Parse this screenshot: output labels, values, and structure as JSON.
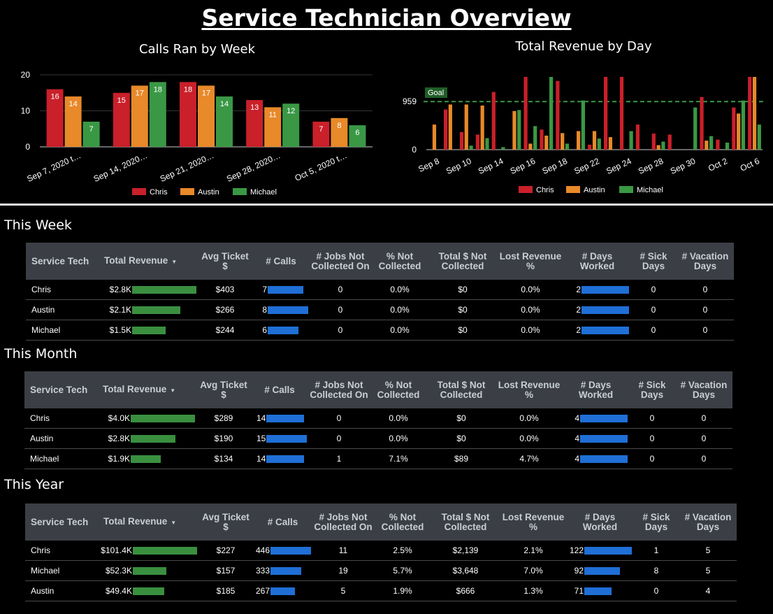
{
  "page_title": "Service Technician Overview",
  "colors": {
    "chris": "#c9202a",
    "austin": "#e8892a",
    "michael": "#3a9845",
    "revenue_bar": "#3a8f3f",
    "metric_bar": "#1f6fd6",
    "goal": "#3a9845",
    "header_bg": "#3b3f45"
  },
  "chart_data": [
    {
      "type": "bar",
      "title": "Calls Ran by Week",
      "categories": [
        "Sep 7, 2020 t…",
        "Sep 14, 2020…",
        "Sep 21, 2020…",
        "Sep 28, 2020…",
        "Oct 5, 2020 t…"
      ],
      "series": [
        {
          "name": "Chris",
          "values": [
            16,
            15,
            18,
            13,
            7
          ]
        },
        {
          "name": "Austin",
          "values": [
            14,
            17,
            17,
            11,
            8
          ]
        },
        {
          "name": "Michael",
          "values": [
            7,
            18,
            14,
            12,
            6
          ]
        }
      ],
      "yticks": [
        "0",
        "10",
        "20"
      ],
      "ylim": [
        0,
        21
      ],
      "data_labels": true,
      "grid": true,
      "legend": "bottom"
    },
    {
      "type": "bar",
      "title": "Total Revenue by Day",
      "x": [
        "Sep 8",
        "Sep 9",
        "Sep 10",
        "Sep 11",
        "Sep 14",
        "Sep 15",
        "Sep 16",
        "Sep 17",
        "Sep 18",
        "Sep 21",
        "Sep 22",
        "Sep 23",
        "Sep 24",
        "Sep 25",
        "Sep 28",
        "Sep 29",
        "Sep 30",
        "Oct 1",
        "Oct 2",
        "Oct 5",
        "Oct 6"
      ],
      "xtick_labels": [
        "Sep 8",
        "Sep 10",
        "Sep 14",
        "Sep 16",
        "Sep 18",
        "Sep 22",
        "Sep 24",
        "Sep 28",
        "Sep 30",
        "Oct 2",
        "Oct 6"
      ],
      "series": [
        {
          "name": "Chris",
          "values": [
            0,
            800,
            350,
            300,
            1150,
            0,
            1450,
            400,
            1370,
            0,
            100,
            1450,
            1450,
            500,
            320,
            300,
            0,
            1050,
            200,
            840,
            1450
          ]
        },
        {
          "name": "Austin",
          "values": [
            500,
            900,
            900,
            880,
            0,
            770,
            120,
            280,
            330,
            370,
            370,
            250,
            0,
            0,
            90,
            0,
            0,
            180,
            0,
            720,
            1450
          ]
        },
        {
          "name": "Michael",
          "values": [
            0,
            0,
            80,
            230,
            50,
            790,
            470,
            1450,
            120,
            980,
            220,
            0,
            370,
            0,
            160,
            0,
            840,
            270,
            140,
            980,
            500
          ]
        }
      ],
      "yticks": [
        "0",
        "959"
      ],
      "goal": {
        "label": "Goal",
        "value": 959
      },
      "ylim": [
        0,
        1450
      ],
      "legend": "bottom"
    }
  ],
  "sections": [
    {
      "title": "This Week",
      "columns": [
        "Service Tech",
        "Total Revenue",
        "Avg Ticket $",
        "# Calls",
        "# Jobs Not Collected On",
        "% Not Collected",
        "Total $ Not Collected",
        "Lost Revenue %",
        "# Days Worked",
        "# Sick Days",
        "# Vacation Days"
      ],
      "sort_indicator": "▼",
      "rows": [
        {
          "tech": "Chris",
          "revenue": "$2.8K",
          "revenue_frac": 1.0,
          "avg_ticket": "$403",
          "calls": "7",
          "calls_frac": 0.88,
          "jobs_not_collected": "0",
          "pct_not_collected": "0.0%",
          "total_not_collected": "$0",
          "lost_revenue": "0.0%",
          "days_worked": "2",
          "days_frac": 1.0,
          "sick_days": "0",
          "vacation_days": "0"
        },
        {
          "tech": "Austin",
          "revenue": "$2.1K",
          "revenue_frac": 0.75,
          "avg_ticket": "$266",
          "calls": "8",
          "calls_frac": 1.0,
          "jobs_not_collected": "0",
          "pct_not_collected": "0.0%",
          "total_not_collected": "$0",
          "lost_revenue": "0.0%",
          "days_worked": "2",
          "days_frac": 1.0,
          "sick_days": "0",
          "vacation_days": "0"
        },
        {
          "tech": "Michael",
          "revenue": "$1.5K",
          "revenue_frac": 0.52,
          "avg_ticket": "$244",
          "calls": "6",
          "calls_frac": 0.75,
          "jobs_not_collected": "0",
          "pct_not_collected": "0.0%",
          "total_not_collected": "$0",
          "lost_revenue": "0.0%",
          "days_worked": "2",
          "days_frac": 1.0,
          "sick_days": "0",
          "vacation_days": "0"
        }
      ]
    },
    {
      "title": "This Month",
      "columns": [
        "Service Tech",
        "Total Revenue",
        "Avg Ticket $",
        "# Calls",
        "# Jobs Not Collected On",
        "% Not Collected",
        "Total $ Not Collected",
        "Lost Revenue %",
        "# Days Worked",
        "# Sick Days",
        "# Vacation Days"
      ],
      "sort_indicator": "▼",
      "rows": [
        {
          "tech": "Chris",
          "revenue": "$4.0K",
          "revenue_frac": 1.0,
          "avg_ticket": "$289",
          "calls": "14",
          "calls_frac": 0.93,
          "jobs_not_collected": "0",
          "pct_not_collected": "0.0%",
          "total_not_collected": "$0",
          "lost_revenue": "0.0%",
          "days_worked": "4",
          "days_frac": 1.0,
          "sick_days": "0",
          "vacation_days": "0"
        },
        {
          "tech": "Austin",
          "revenue": "$2.8K",
          "revenue_frac": 0.7,
          "avg_ticket": "$190",
          "calls": "15",
          "calls_frac": 1.0,
          "jobs_not_collected": "0",
          "pct_not_collected": "0.0%",
          "total_not_collected": "$0",
          "lost_revenue": "0.0%",
          "days_worked": "4",
          "days_frac": 1.0,
          "sick_days": "0",
          "vacation_days": "0"
        },
        {
          "tech": "Michael",
          "revenue": "$1.9K",
          "revenue_frac": 0.47,
          "avg_ticket": "$134",
          "calls": "14",
          "calls_frac": 0.93,
          "jobs_not_collected": "1",
          "pct_not_collected": "7.1%",
          "total_not_collected": "$89",
          "lost_revenue": "4.7%",
          "days_worked": "4",
          "days_frac": 1.0,
          "sick_days": "0",
          "vacation_days": "0"
        }
      ]
    },
    {
      "title": "This Year",
      "columns": [
        "Service Tech",
        "Total Revenue",
        "Avg Ticket $",
        "# Calls",
        "# Jobs Not Collected On",
        "% Not Collected",
        "Total $ Not Collected",
        "Lost Revenue %",
        "# Days Worked",
        "# Sick Days",
        "# Vacation Days"
      ],
      "sort_indicator": "▼",
      "rows": [
        {
          "tech": "Chris",
          "revenue": "$101.4K",
          "revenue_frac": 1.0,
          "avg_ticket": "$227",
          "calls": "446",
          "calls_frac": 1.0,
          "jobs_not_collected": "11",
          "pct_not_collected": "2.5%",
          "total_not_collected": "$2,139",
          "lost_revenue": "2.1%",
          "days_worked": "122",
          "days_frac": 1.0,
          "sick_days": "1",
          "vacation_days": "5"
        },
        {
          "tech": "Michael",
          "revenue": "$52.3K",
          "revenue_frac": 0.52,
          "avg_ticket": "$157",
          "calls": "333",
          "calls_frac": 0.75,
          "jobs_not_collected": "19",
          "pct_not_collected": "5.7%",
          "total_not_collected": "$3,648",
          "lost_revenue": "7.0%",
          "days_worked": "92",
          "days_frac": 0.75,
          "sick_days": "8",
          "vacation_days": "5"
        },
        {
          "tech": "Austin",
          "revenue": "$49.4K",
          "revenue_frac": 0.49,
          "avg_ticket": "$185",
          "calls": "267",
          "calls_frac": 0.6,
          "jobs_not_collected": "5",
          "pct_not_collected": "1.9%",
          "total_not_collected": "$666",
          "lost_revenue": "1.3%",
          "days_worked": "71",
          "days_frac": 0.58,
          "sick_days": "0",
          "vacation_days": "4"
        }
      ]
    }
  ]
}
